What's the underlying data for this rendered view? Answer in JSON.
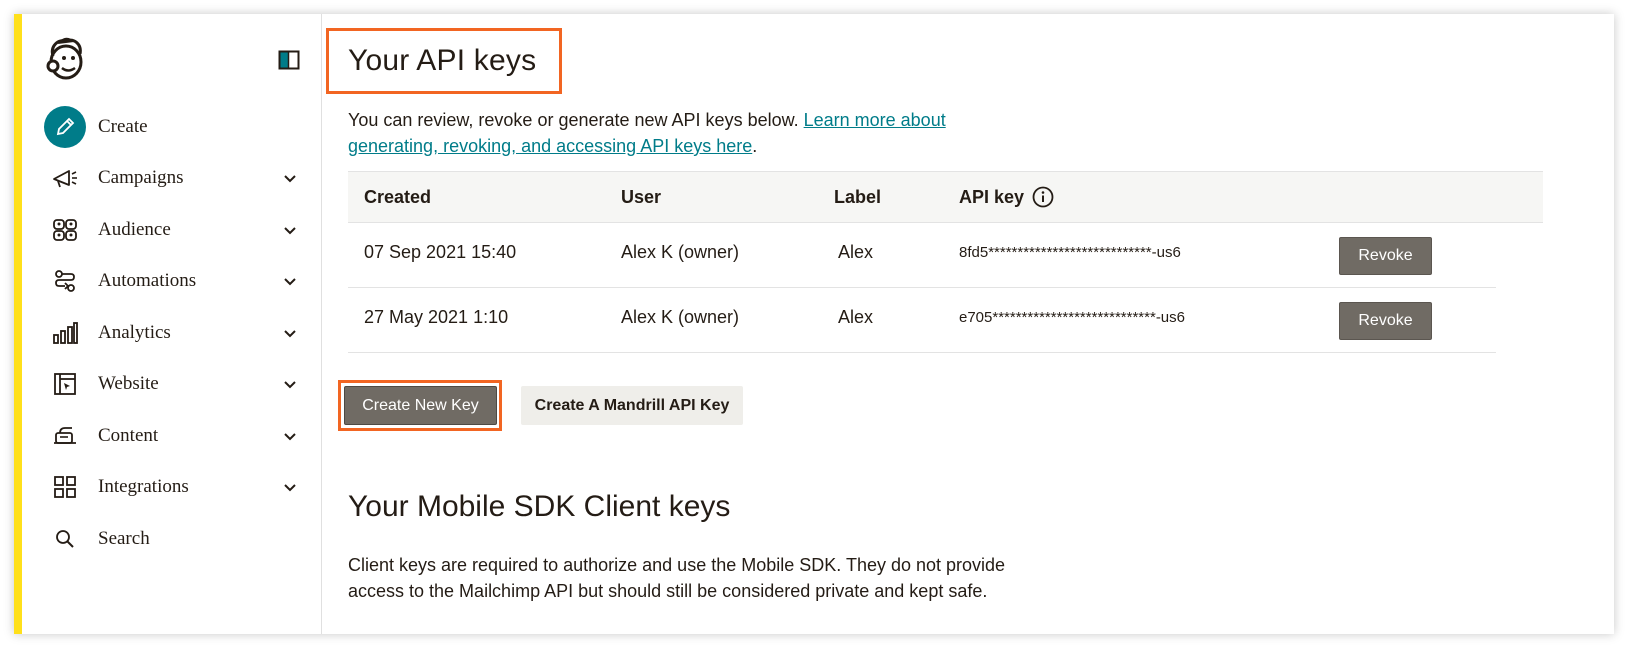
{
  "sidebar": {
    "logo_icon": "mailchimp-freddie-logo",
    "collapse_icon": "sidebar-toggle-icon",
    "items": [
      {
        "label": "Create",
        "icon": "pencil-icon",
        "expandable": false
      },
      {
        "label": "Campaigns",
        "icon": "megaphone-icon",
        "expandable": true
      },
      {
        "label": "Audience",
        "icon": "audience-icon",
        "expandable": true
      },
      {
        "label": "Automations",
        "icon": "automations-icon",
        "expandable": true
      },
      {
        "label": "Analytics",
        "icon": "bar-chart-icon",
        "expandable": true
      },
      {
        "label": "Website",
        "icon": "website-icon",
        "expandable": true
      },
      {
        "label": "Content",
        "icon": "content-icon",
        "expandable": true
      },
      {
        "label": "Integrations",
        "icon": "grid-icon",
        "expandable": true
      },
      {
        "label": "Search",
        "icon": "search-icon",
        "expandable": false
      }
    ]
  },
  "main": {
    "title": "Your API keys",
    "intro_text": "You can review, revoke or generate new API keys below. ",
    "intro_link": "Learn more about generating, revoking, and accessing API keys here",
    "intro_end": ".",
    "table": {
      "headers": [
        "Created",
        "User",
        "Label",
        "API key"
      ],
      "rows": [
        {
          "created": "07 Sep 2021 15:40",
          "user": "Alex K (owner)",
          "label": "Alex",
          "api_key": "8fd5****************************-us6",
          "action": "Revoke"
        },
        {
          "created": "27 May 2021 1:10",
          "user": "Alex K (owner)",
          "label": "Alex",
          "api_key": "e705****************************-us6",
          "action": "Revoke"
        }
      ]
    },
    "create_key_label": "Create New Key",
    "mandrill_label": "Create A Mandrill API Key",
    "sdk_title": "Your Mobile SDK Client keys",
    "sdk_desc": "Client keys are required to authorize and use the Mobile SDK. They do not provide access to the Mailchimp API but should still be considered private and kept safe."
  },
  "colors": {
    "accent_yellow": "#ffe01b",
    "teal": "#007c89",
    "highlight_orange": "#f26522",
    "button_gray": "#706b64"
  }
}
